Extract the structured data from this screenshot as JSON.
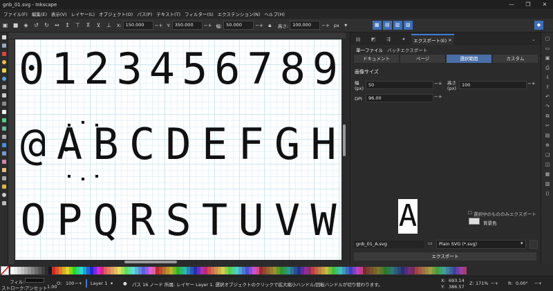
{
  "window": {
    "title": "gnb_01.svg - Inkscape",
    "controls": [
      "—",
      "❐",
      "✕"
    ]
  },
  "menu": [
    "ファイル(F)",
    "編集(E)",
    "表示(V)",
    "レイヤー(L)",
    "オブジェクト(O)",
    "パス(P)",
    "テキスト(T)",
    "フィルター(S)",
    "エクステンション(N)",
    "ヘルプ(H)"
  ],
  "toolctrl": {
    "x_label": "X:",
    "x_value": "150.000",
    "y_label": "Y:",
    "y_value": "350.000",
    "w_label": "幅:",
    "w_value": "50.000",
    "h_label": "高さ:",
    "h_value": "100.000",
    "unit": "px"
  },
  "canvas": {
    "row1": [
      "0",
      "1",
      "2",
      "3",
      "4",
      "5",
      "6",
      "7",
      "8",
      "9"
    ],
    "row2": [
      "@",
      "A",
      "B",
      "C",
      "D",
      "E",
      "F",
      "G",
      "H"
    ],
    "row3": [
      "O",
      "P",
      "Q",
      "R",
      "S",
      "T",
      "U",
      "V",
      "W"
    ]
  },
  "dock": {
    "active_tab": "エクスポート(E)",
    "subtabs": [
      "単一ファイル",
      "バッチエクスポート"
    ],
    "area_tabs": [
      "ドキュメント",
      "ページ",
      "選択範囲",
      "カスタム"
    ],
    "image_size_title": "画像サイズ",
    "width_label": "幅",
    "width_unit": "(px)",
    "width_value": "50",
    "height_label": "高さ",
    "height_unit": "(px)",
    "height_value": "100",
    "dpi_label": "DPI",
    "dpi_value": "96.00",
    "preview_glyph": "A",
    "export_selected_only": "選択中のもののみエクスポート",
    "background_label": "背景色",
    "filename": "gnb_01_A.svg",
    "format": "Plain SVG (*.svg)",
    "export_button": "エクスポート"
  },
  "status": {
    "fill_label": "フィル:",
    "stroke_label": "ストローク:",
    "stroke_value": "アンセット",
    "stroke_width": "1.00",
    "opacity_label": "O:",
    "opacity_value": "100",
    "layer": "Layer 1",
    "message": "パス 16 ノード 所属: レイヤー Layer 1. 選択オブジェクトのクリックで拡大縮小ハンドル/回転ハンドルが切り替わります。",
    "x_label": "X:",
    "x_value": "693.14",
    "y_label": "Y:",
    "y_value": "386.57",
    "zoom_label": "Z:",
    "zoom_value": "171%",
    "rotate_label": "R:",
    "rotate_value": "0.00°"
  },
  "colors": {
    "accent": "#3d7bd6",
    "canvas": "#ffffff",
    "grid": "#cfe6f0"
  }
}
